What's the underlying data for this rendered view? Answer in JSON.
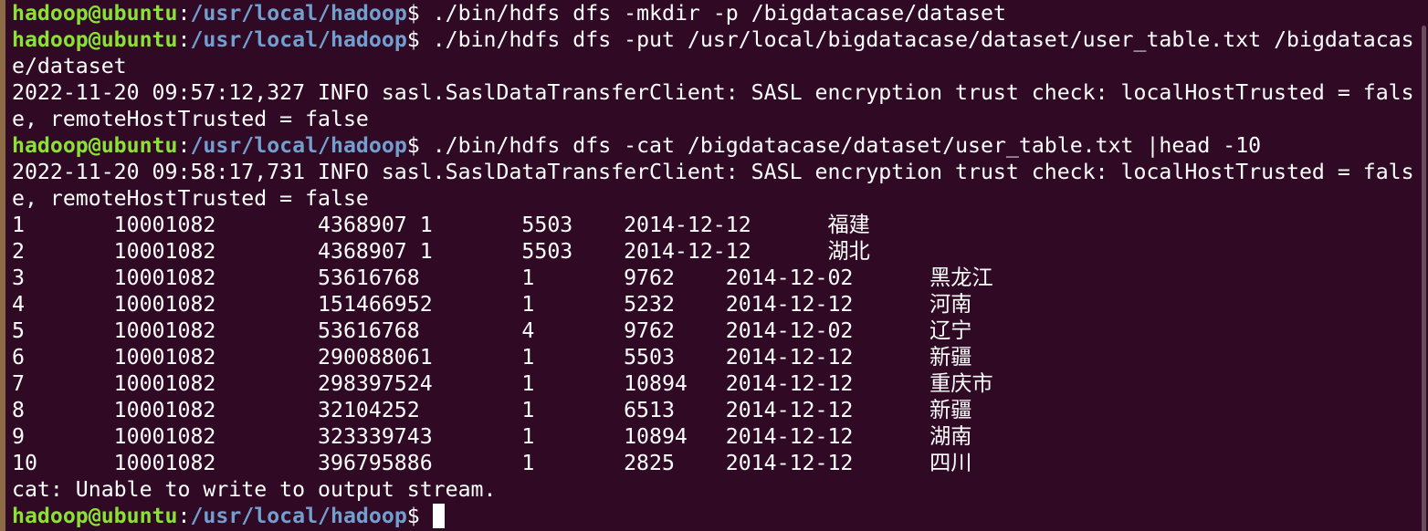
{
  "prompt": {
    "user": "hadoop@ubuntu",
    "colon": ":",
    "path": "/usr/local/hadoop",
    "dollar": "$"
  },
  "lines": [
    {
      "type": "prompt",
      "command": " ./bin/hdfs dfs -mkdir -p /bigdatacase/dataset"
    },
    {
      "type": "prompt",
      "command": " ./bin/hdfs dfs -put /usr/local/bigdatacase/dataset/user_table.txt /bigdatacas"
    },
    {
      "type": "text",
      "text": "e/dataset"
    },
    {
      "type": "text",
      "text": "2022-11-20 09:57:12,327 INFO sasl.SaslDataTransferClient: SASL encryption trust check: localHostTrusted = fals"
    },
    {
      "type": "text",
      "text": "e, remoteHostTrusted = false"
    },
    {
      "type": "prompt",
      "command": " ./bin/hdfs dfs -cat /bigdatacase/dataset/user_table.txt |head -10"
    },
    {
      "type": "text",
      "text": "2022-11-20 09:58:17,731 INFO sasl.SaslDataTransferClient: SASL encryption trust check: localHostTrusted = fals"
    },
    {
      "type": "text",
      "text": "e, remoteHostTrusted = false"
    },
    {
      "type": "text",
      "text": "1       10001082        4368907 1       5503    2014-12-12      福建"
    },
    {
      "type": "text",
      "text": "2       10001082        4368907 1       5503    2014-12-12      湖北"
    },
    {
      "type": "text",
      "text": "3       10001082        53616768        1       9762    2014-12-02      黑龙江"
    },
    {
      "type": "text",
      "text": "4       10001082        151466952       1       5232    2014-12-12      河南"
    },
    {
      "type": "text",
      "text": "5       10001082        53616768        4       9762    2014-12-02      辽宁"
    },
    {
      "type": "text",
      "text": "6       10001082        290088061       1       5503    2014-12-12      新疆"
    },
    {
      "type": "text",
      "text": "7       10001082        298397524       1       10894   2014-12-12      重庆市"
    },
    {
      "type": "text",
      "text": "8       10001082        32104252        1       6513    2014-12-12      新疆"
    },
    {
      "type": "text",
      "text": "9       10001082        323339743       1       10894   2014-12-12      湖南"
    },
    {
      "type": "text",
      "text": "10      10001082        396795886       1       2825    2014-12-12      四川"
    },
    {
      "type": "text",
      "text": "cat: Unable to write to output stream."
    },
    {
      "type": "prompt",
      "command": "",
      "cursor": true
    }
  ]
}
